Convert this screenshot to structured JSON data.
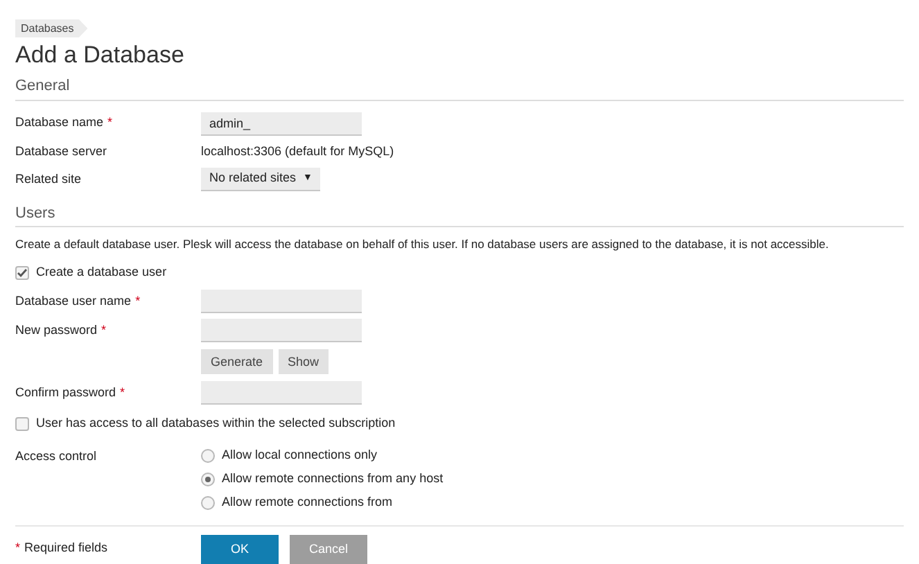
{
  "breadcrumb": "Databases",
  "title": "Add a Database",
  "general": {
    "heading": "General",
    "rows": [
      {
        "kind": "input",
        "label": "Database name",
        "mark": "*",
        "value": "admin_"
      },
      {
        "kind": "text",
        "label": "Database server",
        "value": "localhost:3306 (default for MySQL)"
      },
      {
        "kind": "select",
        "label": "Related site",
        "value": "No related sites",
        "caret": "▼"
      }
    ]
  },
  "users": {
    "heading": "Users",
    "description": "Create a default database user. Plesk will access the database on behalf of this user. If no database users are assigned to the database, it is not accessible.",
    "create_user": {
      "label": "Create a database user",
      "checked": true
    },
    "fields": [
      {
        "kind": "input",
        "label": "Database user name",
        "mark": "*"
      },
      {
        "kind": "input",
        "label": "New password",
        "mark": "*"
      },
      {
        "kind": "buttons",
        "buttons": [
          "Generate",
          "Show"
        ]
      },
      {
        "kind": "input",
        "label": "Confirm password",
        "mark": "*"
      }
    ],
    "all_access": {
      "label": "User has access to all databases within the selected subscription",
      "checked": false
    },
    "access_control": {
      "label": "Access control",
      "options": [
        {
          "label": "Allow local connections only",
          "selected": false
        },
        {
          "label": "Allow remote connections from any host",
          "selected": true
        },
        {
          "label": "Allow remote connections from",
          "selected": false
        }
      ]
    }
  },
  "footer": {
    "mark": "*",
    "note": "Required fields",
    "ok": "OK",
    "cancel": "Cancel"
  }
}
